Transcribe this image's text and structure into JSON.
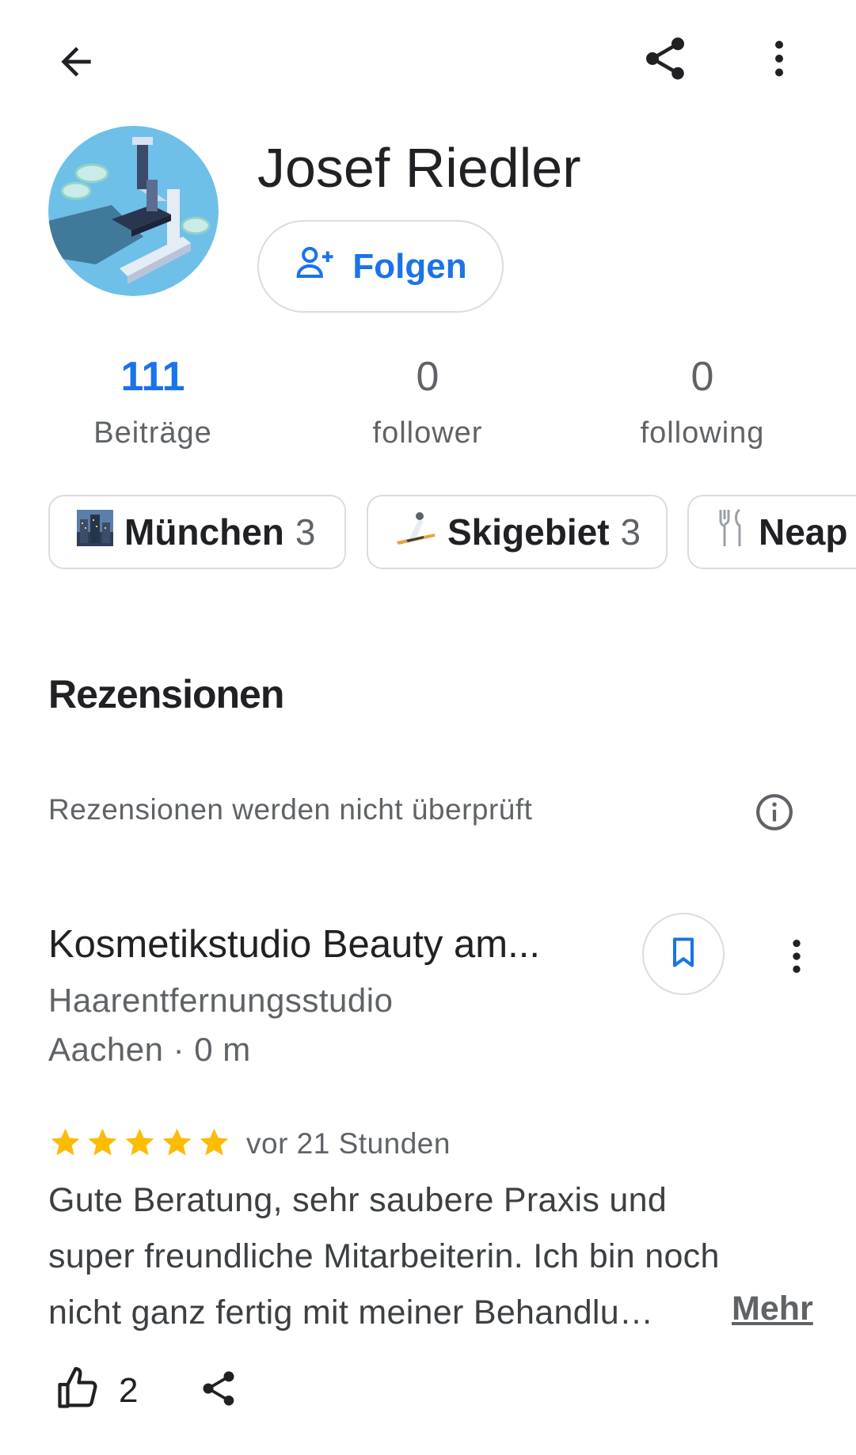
{
  "profile": {
    "name": "Josef Riedler",
    "follow_label": "Folgen"
  },
  "stats": [
    {
      "value": "111",
      "label": "Beiträge"
    },
    {
      "value": "0",
      "label": "follower"
    },
    {
      "value": "0",
      "label": "following"
    }
  ],
  "chips": [
    {
      "icon": "city-icon",
      "label": "München",
      "count": "3"
    },
    {
      "icon": "ski-icon",
      "label": "Skigebiet",
      "count": "3"
    },
    {
      "icon": "fork-knife-icon",
      "label": "Neap",
      "count": ""
    }
  ],
  "reviews_section": {
    "title": "Rezensionen",
    "notice": "Rezensionen werden nicht überprüft"
  },
  "review": {
    "place_name": "Kosmetikstudio Beauty am...",
    "category": "Haarentfernungsstudio",
    "location": "Aachen · 0 m",
    "rating": 5,
    "time": "vor 21 Stunden",
    "text_lines": [
      "Gute Beratung, sehr saubere Praxis und",
      "super freundliche Mitarbeiterin. Ich bin noch",
      "nicht ganz fertig mit meiner Behandlu…"
    ],
    "more_label": "Mehr",
    "likes": "2"
  },
  "colors": {
    "accent": "#1a73e8",
    "star": "#fbbc04",
    "text_secondary": "#5f6368",
    "border": "#dadce0"
  }
}
